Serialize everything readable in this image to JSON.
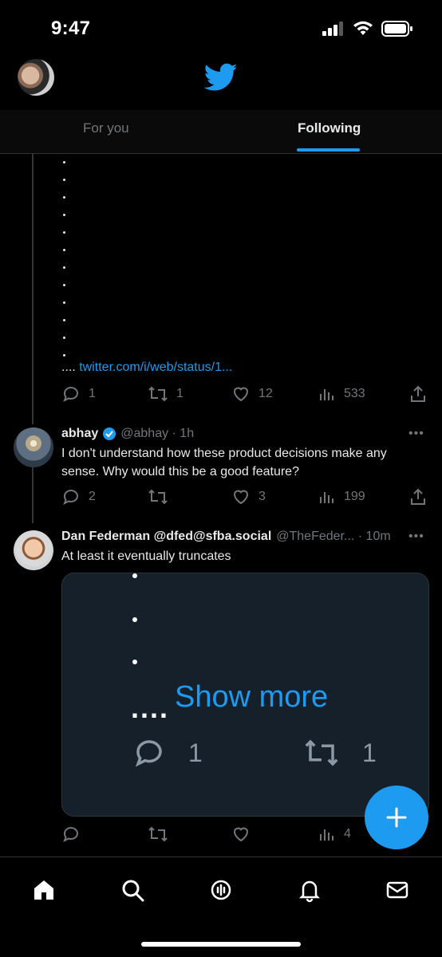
{
  "status_bar": {
    "time": "9:47"
  },
  "header": {
    "logo": "twitter-bird-icon"
  },
  "tabs": [
    {
      "label": "For you",
      "active": false
    },
    {
      "label": "Following",
      "active": true
    }
  ],
  "tweet1": {
    "truncated_prefix": "....",
    "link_text": "twitter.com/i/web/status/1...",
    "replies": "1",
    "retweets": "1",
    "likes": "12",
    "views": "533"
  },
  "tweet2": {
    "name": "abhay",
    "verified": true,
    "handle_time": "@abhay · 1h",
    "text": "I don't understand how these product decisions make any sense. Why would this be a good feature?",
    "replies": "2",
    "retweets": "",
    "likes": "3",
    "views": "199"
  },
  "tweet3": {
    "name": "Dan Federman @dfed@sfba.social",
    "handle_time": "@TheFeder... · 10m",
    "text": "At least it eventually truncates",
    "media": {
      "prefix": "....",
      "show_more": "Show more",
      "replies": "1",
      "retweets": "1"
    },
    "replies": "",
    "retweets": "",
    "likes": "",
    "views": "4"
  },
  "more_label": "•••",
  "colors": {
    "accent": "#1d9bf0",
    "background": "#000000",
    "muted": "#71767b"
  },
  "bottom_nav": [
    "home-icon",
    "search-icon",
    "spaces-icon",
    "notifications-icon",
    "messages-icon"
  ]
}
